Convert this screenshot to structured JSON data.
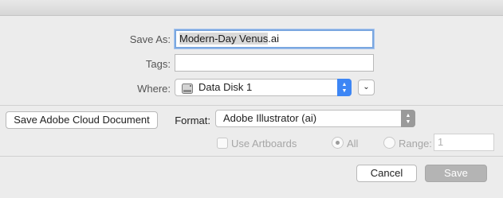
{
  "save_as": {
    "label": "Save As:",
    "name_base": "Modern-Day Venus",
    "extension": ".ai"
  },
  "tags": {
    "label": "Tags:",
    "value": ""
  },
  "where": {
    "label": "Where:",
    "value": "Data Disk 1",
    "icon": "disk-icon",
    "expand_icon": "chevron-down-icon"
  },
  "cloud_button": {
    "label": "Save Adobe Cloud Document"
  },
  "format": {
    "label": "Format:",
    "value": "Adobe Illustrator (ai)"
  },
  "artboards": {
    "use_artboards_label": "Use Artboards",
    "use_artboards_checked": false,
    "all_label": "All",
    "all_selected": true,
    "range_label": "Range:",
    "range_value": "1"
  },
  "footer": {
    "cancel_label": "Cancel",
    "save_label": "Save"
  },
  "colors": {
    "popup_arrow_blue": "#3d86f5",
    "popup_arrow_gray": "#9a9a9a",
    "focus_ring": "#7aa7e0"
  }
}
